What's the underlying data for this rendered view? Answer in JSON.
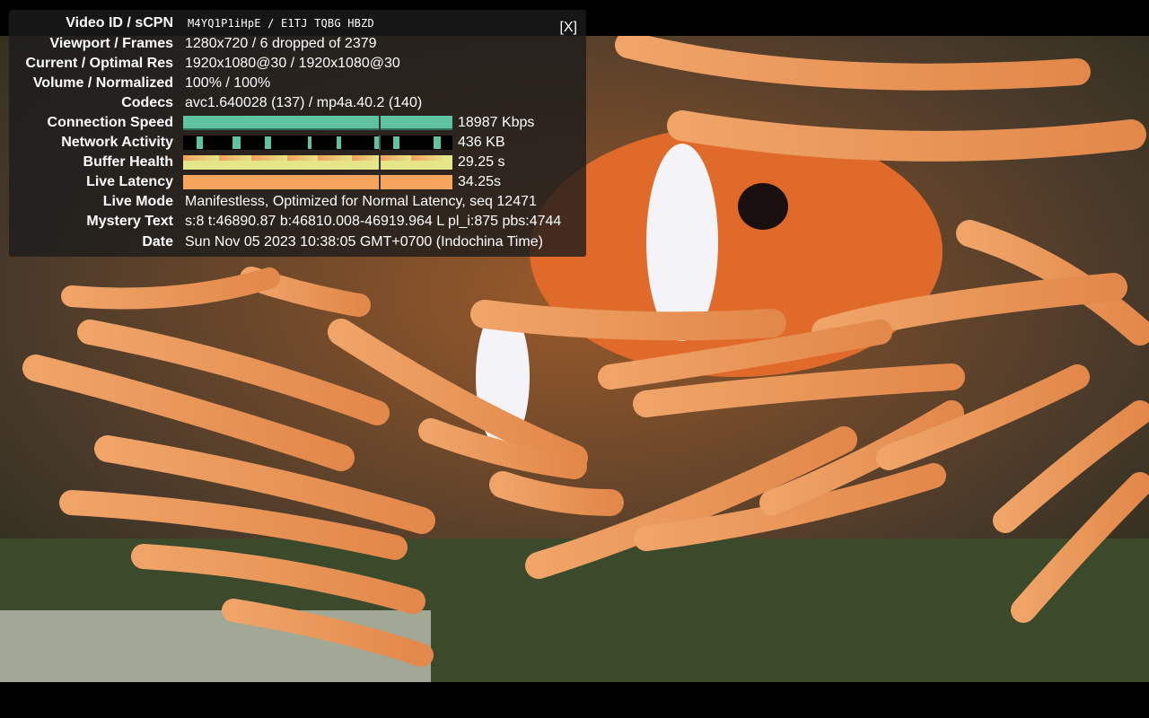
{
  "panel": {
    "close_label": "[X]"
  },
  "rows": {
    "video_id": {
      "label": "Video ID / sCPN",
      "value": "M4YQ1P1iHpE / E1TJ TQBG HBZD"
    },
    "viewport": {
      "label": "Viewport / Frames",
      "value": "1280x720 / 6 dropped of 2379"
    },
    "resolution": {
      "label": "Current / Optimal Res",
      "value": "1920x1080@30 / 1920x1080@30"
    },
    "volume": {
      "label": "Volume / Normalized",
      "value": "100% / 100%"
    },
    "codecs": {
      "label": "Codecs",
      "value": "avc1.640028 (137) / mp4a.40.2 (140)"
    },
    "connection_speed": {
      "label": "Connection Speed",
      "value": "18987 Kbps",
      "color": "#5fc3a1"
    },
    "network_activity": {
      "label": "Network Activity",
      "value": "436 KB",
      "color": "#5fc3a1"
    },
    "buffer_health": {
      "label": "Buffer Health",
      "value": "29.25 s",
      "color": "#e5e58a"
    },
    "live_latency": {
      "label": "Live Latency",
      "value": "34.25s",
      "color": "#f7a45e"
    },
    "live_mode": {
      "label": "Live Mode",
      "value": "Manifestless, Optimized for Normal Latency, seq 12471"
    },
    "mystery_text": {
      "label": "Mystery Text",
      "value": "s:8 t:46890.87 b:46810.008-46919.964 L pl_i:875 pbs:4744"
    },
    "date": {
      "label": "Date",
      "value": "Sun Nov 05 2023 10:38:05 GMT+0700 (Indochina Time)"
    }
  }
}
